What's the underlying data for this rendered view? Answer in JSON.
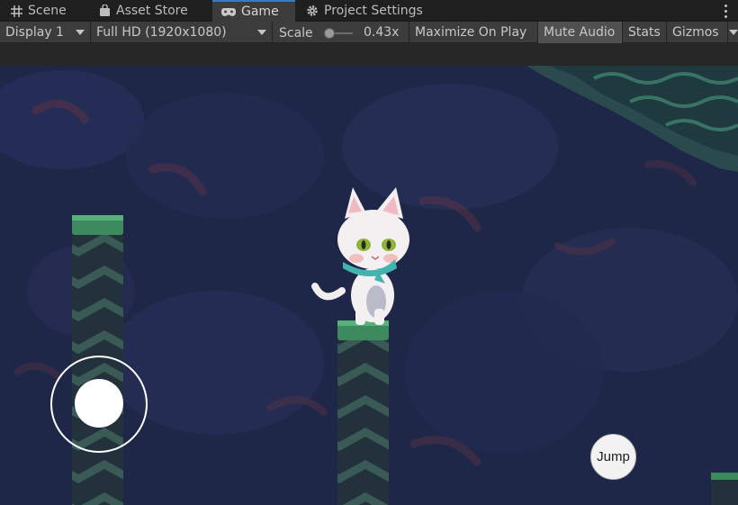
{
  "tabs": [
    {
      "label": "Scene",
      "icon": "grid-icon"
    },
    {
      "label": "Asset Store",
      "icon": "shopping-bag-icon"
    },
    {
      "label": "Game",
      "icon": "gamepad-icon",
      "active": true
    },
    {
      "label": "Project Settings",
      "icon": "gear-icon"
    }
  ],
  "toolbar": {
    "display": "Display 1",
    "resolution": "Full HD (1920x1080)",
    "scale_label": "Scale",
    "scale_value": "0.43x",
    "maximize": "Maximize On Play",
    "mute": "Mute Audio",
    "stats": "Stats",
    "gizmos": "Gizmos"
  },
  "game": {
    "jump_label": "Jump"
  },
  "colors": {
    "accent": "#3a79bb",
    "background": "#1e2747",
    "tile_green": "#3e8a5f"
  }
}
